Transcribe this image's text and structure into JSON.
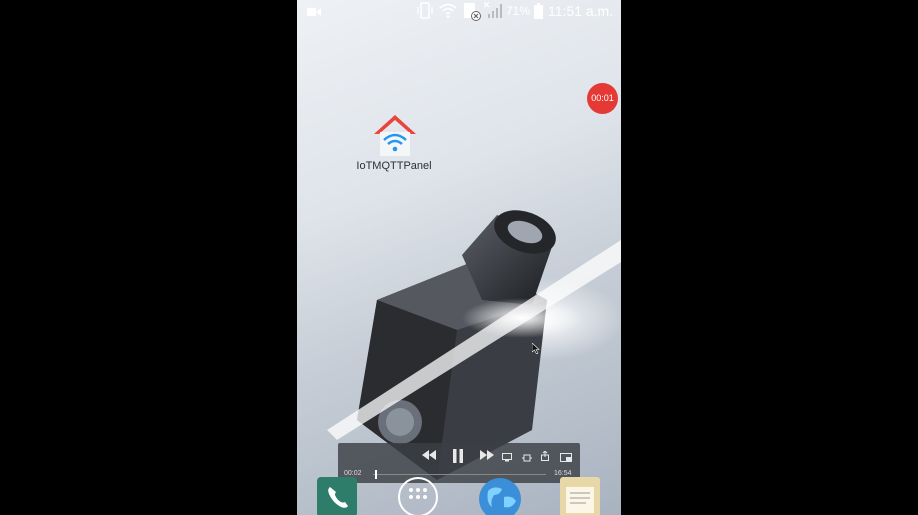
{
  "status_bar": {
    "battery_percent": "71%",
    "time": "11:51 a.m.",
    "icons": [
      "video-call-icon",
      "vibrate-icon",
      "wifi-icon",
      "data-blocked-icon",
      "no-signal-icon",
      "battery-icon"
    ]
  },
  "home": {
    "app_label": "IoTMQTTPanel"
  },
  "recording": {
    "elapsed": "00:01"
  },
  "player": {
    "current_time": "00:02",
    "duration": "16:54",
    "progress_fraction": 0.01
  },
  "dock": {
    "apps": [
      "phone-icon",
      "app-drawer-icon",
      "browser-icon",
      "notes-icon"
    ]
  },
  "colors": {
    "record_red": "#e53935",
    "wifi_blue": "#2196f3",
    "house_red": "#e8453c",
    "phone_green": "#2e7d6b"
  }
}
